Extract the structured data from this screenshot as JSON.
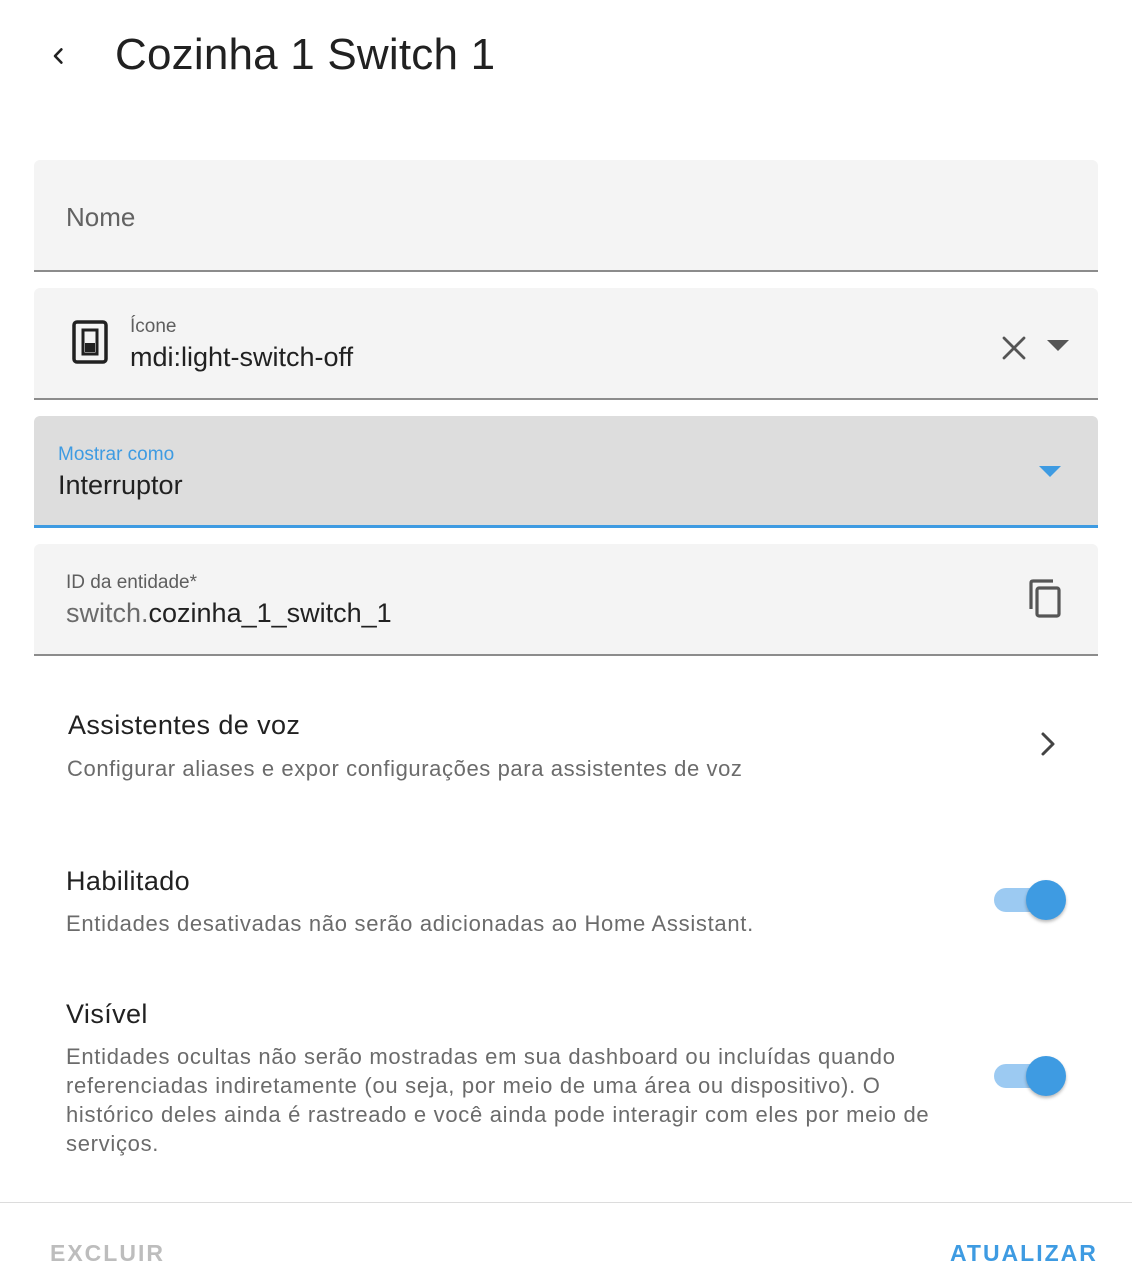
{
  "header": {
    "title": "Cozinha 1 Switch 1",
    "back_icon": "chevron-left-icon"
  },
  "name_field": {
    "placeholder": "Nome",
    "value": ""
  },
  "icon_field": {
    "label": "Ícone",
    "value": "mdi:light-switch-off",
    "leading_icon": "light-switch-off-icon",
    "clear_icon": "close-icon",
    "dropdown_icon": "menu-down-icon"
  },
  "show_as_field": {
    "label": "Mostrar como",
    "value": "Interruptor",
    "dropdown_icon": "menu-down-icon"
  },
  "entity_id_field": {
    "label": "ID da entidade*",
    "prefix": "switch.",
    "value": "cozinha_1_switch_1",
    "copy_icon": "content-copy-icon"
  },
  "voice_assistants": {
    "title": "Assistentes de voz",
    "description": "Configurar aliases e expor configurações para assistentes de voz",
    "chevron_icon": "chevron-right-icon"
  },
  "enabled_setting": {
    "title": "Habilitado",
    "description": "Entidades desativadas não serão adicionadas ao Home Assistant.",
    "checked": true
  },
  "visible_setting": {
    "title": "Visível",
    "description": "Entidades ocultas não serão mostradas em sua dashboard ou incluídas quando referenciadas indiretamente (ou seja, por meio de uma área ou dispositivo). O histórico deles ainda é rastreado e você ainda pode interagir com eles por meio de serviços.",
    "checked": true
  },
  "footer": {
    "delete_label": "EXCLUIR",
    "update_label": "ATUALIZAR"
  },
  "colors": {
    "accent": "#3e9be2",
    "toggle_track": "#9ccaf2",
    "disabled_text": "#bdbdbd"
  }
}
